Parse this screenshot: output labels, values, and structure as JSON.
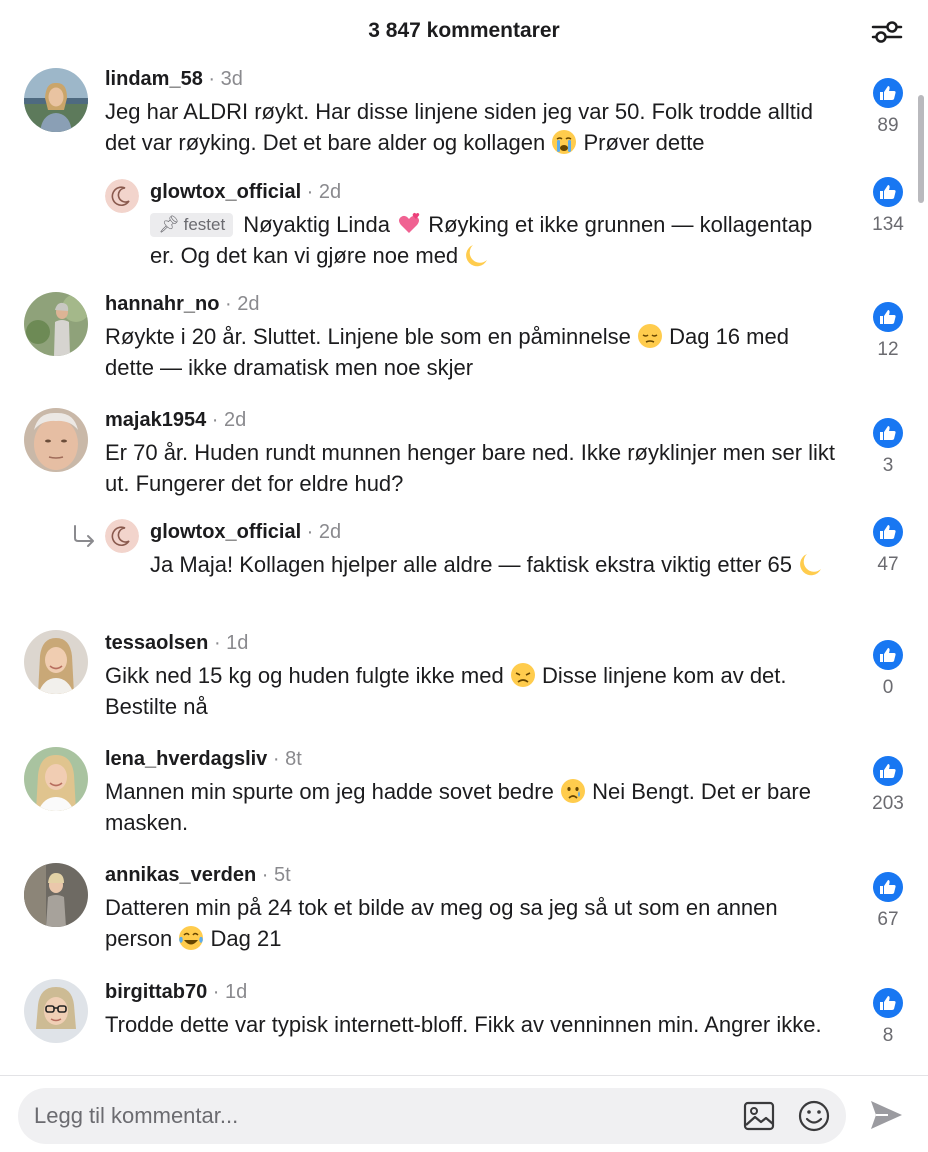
{
  "header": {
    "title": "3 847 kommentarer",
    "filter_icon": "sliders-icon"
  },
  "colors": {
    "like": "#1877f2",
    "muted": "#8a8a8e",
    "pinned_bg": "#ececee"
  },
  "comments": [
    {
      "username": "lindam_58",
      "time": "3d",
      "text_parts": [
        "Jeg har ALDRI røykt. Har disse linjene siden jeg var 50. Folk trodde alltid det var røyking. Det et bare alder og kollagen",
        "Prøver dette"
      ],
      "emoji": "crying-face",
      "likes": "89"
    },
    {
      "username": "glowtox_official",
      "time": "2d",
      "pinned_label": "festet",
      "text_parts": [
        "Nøyaktig Linda",
        "Røyking et ikke grunnen — kollagentap er. Og det kan vi gjøre noe med"
      ],
      "emoji": "two-hearts",
      "emoji_end": "crescent-moon",
      "likes": "134"
    },
    {
      "username": "hannahr_no",
      "time": "2d",
      "text_parts": [
        "Røykte i 20 år. Sluttet. Linjene ble som en påminnelse",
        "Dag 16 med dette — ikke dramatisk men noe skjer"
      ],
      "emoji": "pensive-face",
      "likes": "12"
    },
    {
      "username": "majak1954",
      "time": "2d",
      "text": "Er 70 år. Huden rundt munnen henger bare ned. Ikke røyklinjer men ser likt ut. Fungerer det for eldre hud?",
      "likes": "3"
    },
    {
      "username": "glowtox_official",
      "time": "2d",
      "text": "Ja Maja! Kollagen hjelper alle aldre — faktisk ekstra viktig etter 65",
      "emoji_end": "crescent-moon",
      "likes": "47"
    },
    {
      "username": "tessaolsen",
      "time": "1d",
      "text_parts": [
        "Gikk ned 15 kg og huden fulgte ikke med",
        "Disse linjene kom av det. Bestilte nå"
      ],
      "emoji": "disappointed-face",
      "likes": "0"
    },
    {
      "username": "lena_hverdagsliv",
      "time": "8t",
      "text_parts": [
        "Mannen min spurte om jeg hadde sovet bedre",
        "Nei Bengt. Det er bare masken."
      ],
      "emoji": "crying-tear-face",
      "likes": "203"
    },
    {
      "username": "annikas_verden",
      "time": "5t",
      "text_parts": [
        "Datteren min på 24 tok et bilde av meg og sa jeg så ut som en annen person",
        "Dag 21"
      ],
      "emoji": "tears-of-joy",
      "likes": "67"
    },
    {
      "username": "birgittab70",
      "time": "1d",
      "text": "Trodde dette var typisk internett-bloff. Fikk av venninnen min. Angrer ikke.",
      "likes": "8"
    }
  ],
  "composer": {
    "placeholder": "Legg til kommentar...",
    "image_icon": "image-icon",
    "emoji_icon": "smiley-icon",
    "send_icon": "send-icon"
  }
}
